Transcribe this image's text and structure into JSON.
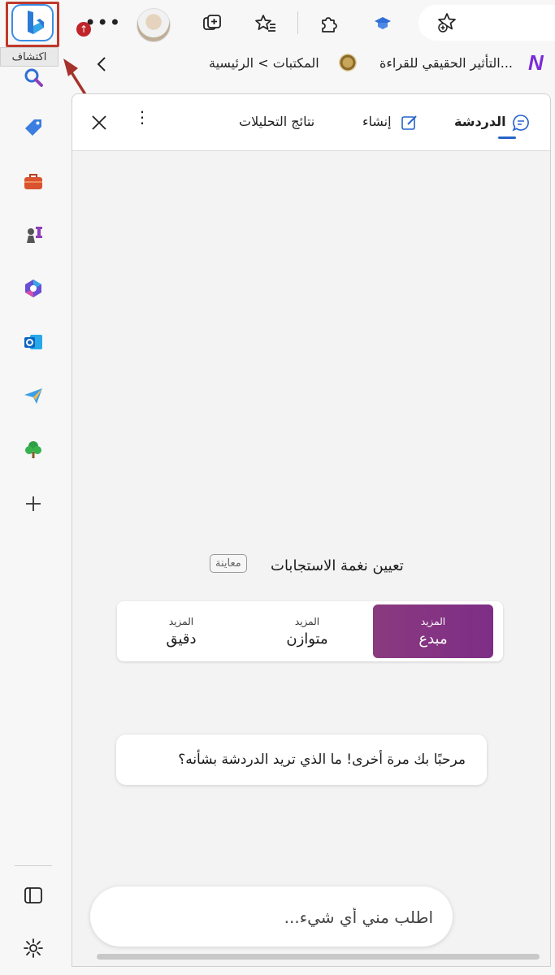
{
  "toolbar": {
    "discover_tooltip": "اكتشاف",
    "more_label": "•••",
    "update_badge": "↑"
  },
  "bookmarks": {
    "item1": "التأثير الحقيقي للقراءة...",
    "item2": "المكتبات > الرئيسية"
  },
  "chat": {
    "tabs": {
      "chat": "الدردشة",
      "compose": "إنشاء",
      "insights": "نتائج التحليلات"
    },
    "tone": {
      "title": "تعيين نغمة الاستجابات",
      "badge": "معاينة",
      "options": [
        {
          "small": "المزيد",
          "label": "مبدع",
          "active": true
        },
        {
          "small": "المزيد",
          "label": "متوازن",
          "active": false
        },
        {
          "small": "المزيد",
          "label": "دقيق",
          "active": false
        }
      ]
    },
    "welcome": "مرحبًا بك مرة أخرى! ما الذي تريد الدردشة بشأنه؟",
    "input_placeholder": "اطلب مني أي شيء..."
  },
  "colors": {
    "accent_blue": "#2563c9",
    "creative_purple": "#8a3a7e",
    "highlight_red": "#c0392b"
  }
}
